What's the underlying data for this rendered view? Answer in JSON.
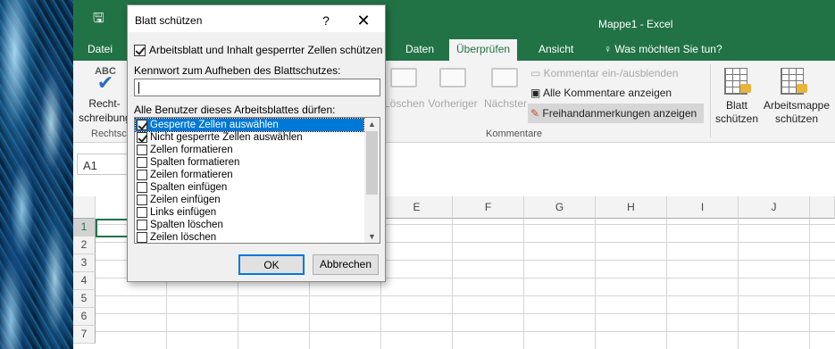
{
  "window": {
    "title": "Mappe1 - Excel"
  },
  "tabs": [
    {
      "label": "Datei"
    },
    {
      "label": "Daten"
    },
    {
      "label": "Überprüfen",
      "active": true
    },
    {
      "label": "Ansicht"
    },
    {
      "label": "Was möchten Sie tun?"
    }
  ],
  "ribbon": {
    "spelling_top": "ABC",
    "spelling_label_1": "Recht-",
    "spelling_label_2": "schreibung",
    "group_rechtschreibung": "Rechtsc",
    "delete_label": "Löschen",
    "prev_label": "Vorheriger",
    "next_label": "Nächster",
    "toggle_comment": "Kommentar ein-/ausblenden",
    "show_all_comments": "Alle Kommentare anzeigen",
    "ink": "Freihandanmerkungen anzeigen",
    "group_kommentare": "Kommentare",
    "protect_sheet_1": "Blatt",
    "protect_sheet_2": "schützen",
    "protect_wb_1": "Arbeitsmappe",
    "protect_wb_2": "schützen"
  },
  "namebox": {
    "value": "A1"
  },
  "columns": [
    "E",
    "F",
    "G",
    "H",
    "I",
    "J"
  ],
  "rows": [
    "1",
    "2",
    "3",
    "4",
    "5",
    "6",
    "7"
  ],
  "dialog": {
    "title": "Blatt schützen",
    "help": "?",
    "close": "✕",
    "protect_check_label": "Arbeitsblatt und Inhalt gesperrter Zellen schützen",
    "protect_checked": true,
    "password_label": "Kennwort zum Aufheben des Blattschutzes:",
    "password_value": "",
    "allow_label": "Alle Benutzer dieses Arbeitsblattes dürfen:",
    "permissions": [
      {
        "label": "Gesperrte Zellen auswählen",
        "checked": true,
        "selected": true
      },
      {
        "label": "Nicht gesperrte Zellen auswählen",
        "checked": true
      },
      {
        "label": "Zellen formatieren",
        "checked": false
      },
      {
        "label": "Spalten formatieren",
        "checked": false
      },
      {
        "label": "Zeilen formatieren",
        "checked": false
      },
      {
        "label": "Spalten einfügen",
        "checked": false
      },
      {
        "label": "Zeilen einfügen",
        "checked": false
      },
      {
        "label": "Links einfügen",
        "checked": false
      },
      {
        "label": "Spalten löschen",
        "checked": false
      },
      {
        "label": "Zeilen löschen",
        "checked": false
      }
    ],
    "ok_label": "OK",
    "cancel_label": "Abbrechen"
  },
  "colors": {
    "excel_green": "#217346",
    "selection_blue": "#0078d7"
  }
}
